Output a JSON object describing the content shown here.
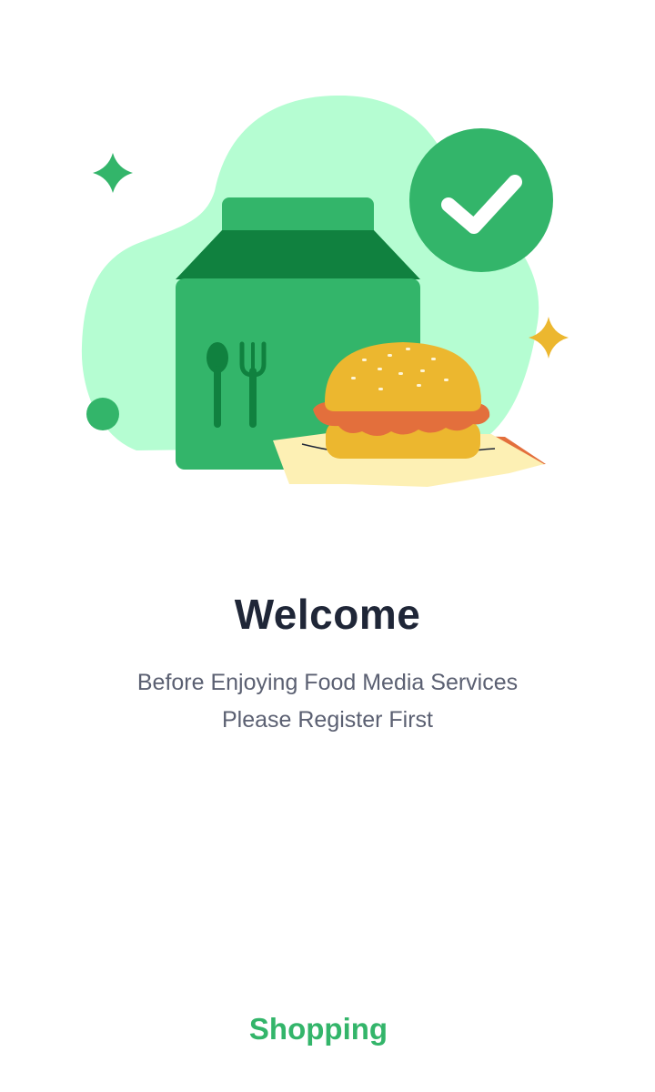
{
  "illustration": {
    "icons": [
      "food-bag-icon",
      "spoon-icon",
      "fork-icon",
      "burger-icon",
      "check-circle-icon",
      "sparkle-icon",
      "dot-icon"
    ]
  },
  "welcome": {
    "title": "Welcome",
    "subtitle_line1": "Before Enjoying Food Media Services",
    "subtitle_line2": "Please Register First"
  },
  "cta": {
    "label": "Shopping"
  },
  "colors": {
    "accent": "#33b56a",
    "accent_dark": "#10813f",
    "blob": "#b5fdd2",
    "title": "#1f2637",
    "subtitle": "#5b6072",
    "bun": "#ecb72f",
    "sauce": "#e36f3c",
    "paper": "#fdf0b4"
  }
}
